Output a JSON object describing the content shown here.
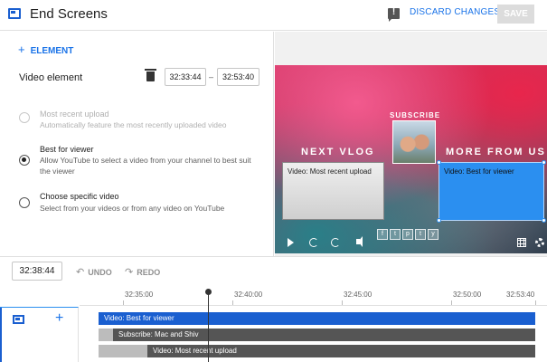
{
  "header": {
    "title": "End Screens",
    "discard_label": "DISCARD CHANGES",
    "save_label": "SAVE"
  },
  "panel": {
    "add_element_label": "ELEMENT",
    "element_label": "Video element",
    "start_time": "32:33:44",
    "end_time": "32:53:40",
    "time_separator": "–",
    "options": [
      {
        "title": "Most recent upload",
        "desc": "Automatically feature the most recently uploaded video",
        "state": "disabled"
      },
      {
        "title": "Best for viewer",
        "desc": "Allow YouTube to select a video from your channel to best suit the viewer",
        "state": "checked"
      },
      {
        "title": "Choose specific video",
        "desc": "Select from your videos or from any video on YouTube",
        "state": "unchecked"
      }
    ]
  },
  "preview": {
    "next_label": "NEXT VLOG",
    "more_label": "MORE FROM US",
    "subscribe_label": "SUBSCRIBE",
    "card_left_text": "Video: Most recent upload",
    "card_right_text": "Video: Best for viewer",
    "socials": [
      "f",
      "t",
      "p",
      "t",
      "y"
    ]
  },
  "toolbar": {
    "current_time": "32:38:44",
    "undo_label": "UNDO",
    "redo_label": "REDO"
  },
  "timeline": {
    "ticks": [
      "32:35:00",
      "32:40:00",
      "32:45:00",
      "32:50:00",
      "32:53:40"
    ],
    "tracks": [
      {
        "label": "Video: Best for viewer"
      },
      {
        "label": "Subscribe: Mac and Shiv"
      },
      {
        "label": "Video: Most recent upload"
      }
    ]
  }
}
